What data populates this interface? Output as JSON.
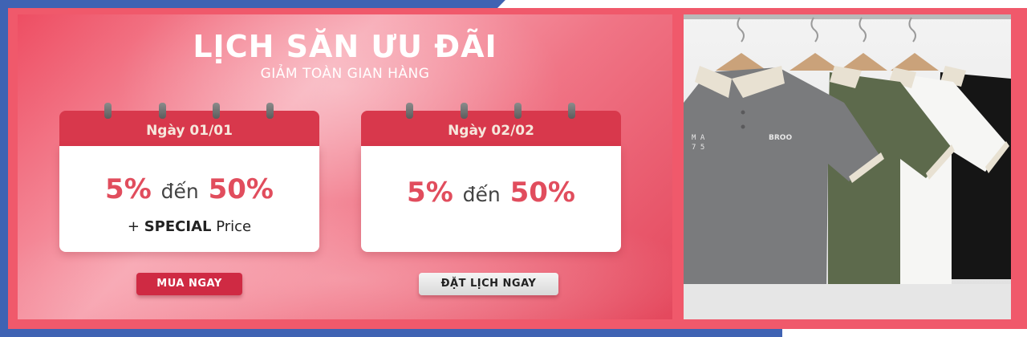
{
  "banner": {
    "title": "LỊCH SĂN ƯU ĐÃI",
    "subtitle": "GIẢM TOÀN GIAN HÀNG"
  },
  "calendars": [
    {
      "date": "Ngày 01/01",
      "discount_from": "5%",
      "discount_joiner": "đến",
      "discount_to": "50%",
      "extra_prefix": "+ ",
      "extra_bold": "SPECIAL",
      "extra_suffix": " Price",
      "button": "MUA NGAY"
    },
    {
      "date": "Ngày 02/02",
      "discount_from": "5%",
      "discount_joiner": "đến",
      "discount_to": "50%",
      "button": "ĐẶT LỊCH NGAY"
    }
  ],
  "product_photo": {
    "shirt_print_1": "MA\n75",
    "shirt_print_2": "BROO",
    "shirt_colors": [
      "#7a7b7d",
      "#5d6a4c",
      "#f6f6f4",
      "#151515"
    ],
    "collar_color": "#e8e1d2"
  },
  "colors": {
    "brand_red": "#d8384c",
    "accent_pink": "#f0596b",
    "frame_blue": "#3f63b3"
  }
}
